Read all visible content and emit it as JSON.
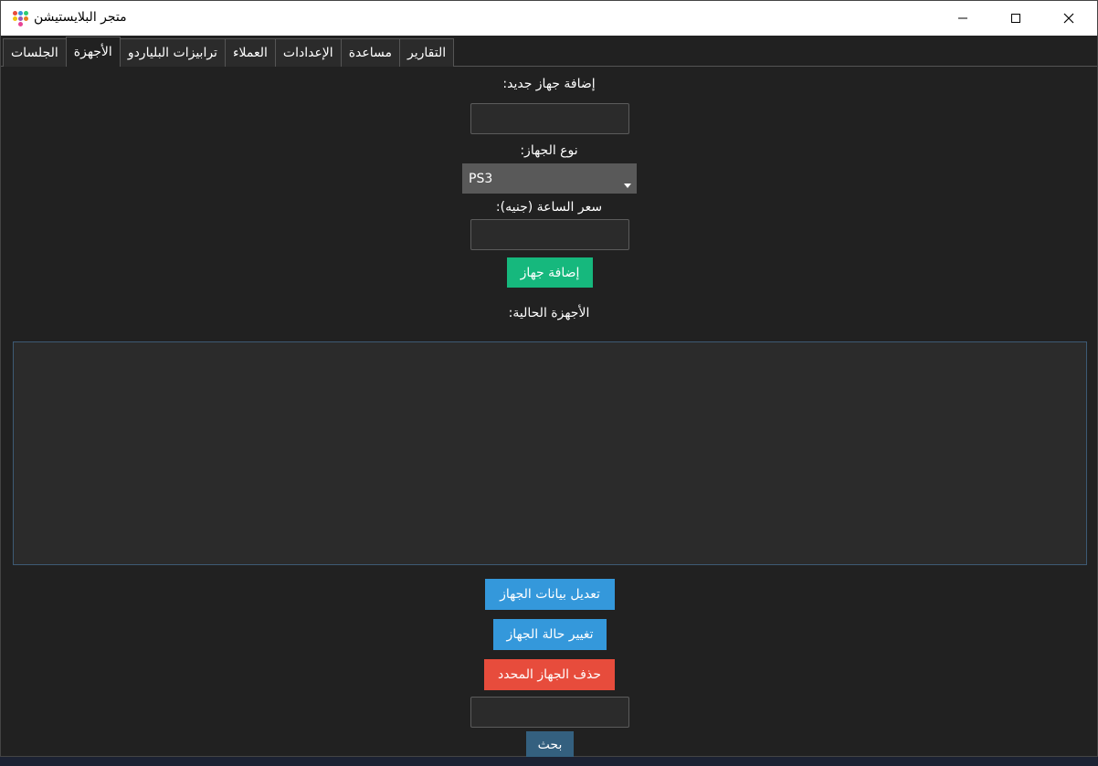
{
  "window": {
    "title": "متجر البلايستيشن",
    "controls": {
      "minimize_icon": "minimize-icon",
      "maximize_icon": "maximize-icon",
      "close_icon": "close-icon"
    }
  },
  "tabs": [
    {
      "label": "الجلسات",
      "active": false
    },
    {
      "label": "الأجهزة",
      "active": true
    },
    {
      "label": "ترابيزات البلياردو",
      "active": false
    },
    {
      "label": "العملاء",
      "active": false
    },
    {
      "label": "الإعدادات",
      "active": false
    },
    {
      "label": "مساعدة",
      "active": false
    },
    {
      "label": "التقارير",
      "active": false
    }
  ],
  "form": {
    "new_device_label": ":إضافة جهاز جديد",
    "new_device_value": "",
    "device_type_label": ":نوع الجهاز",
    "device_type_selected": "PS3",
    "hour_price_label": ":سعر الساعة (جنيه)",
    "hour_price_value": "",
    "add_button": "إضافة جهاز"
  },
  "devices": {
    "label": ":الأجهزة الحالية",
    "items": []
  },
  "actions": {
    "edit_button": "تعديل بيانات الجهاز",
    "change_status_button": "تغيير حالة الجهاز",
    "delete_button": "حذف الجهاز المحدد",
    "search_value": "",
    "search_button": "بحث"
  },
  "colors": {
    "background": "#212121",
    "green": "#16b87d",
    "blue": "#3498db",
    "red": "#e74c3c",
    "dark_blue": "#34607f"
  }
}
